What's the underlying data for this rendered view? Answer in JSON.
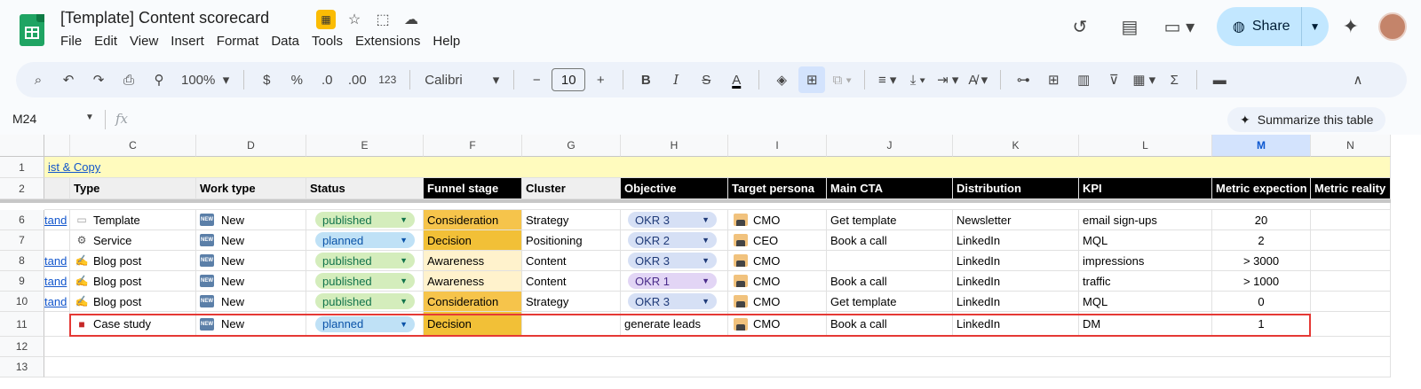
{
  "app": {
    "doc_title": "[Template] Content scorecard",
    "menu": [
      "File",
      "Edit",
      "View",
      "Insert",
      "Format",
      "Data",
      "Tools",
      "Extensions",
      "Help"
    ],
    "share_label": "Share"
  },
  "toolbar": {
    "zoom": "100%",
    "currency": "$",
    "percent": "%",
    "dec_decrease": ".0",
    "dec_increase": ".00",
    "number_format": "123",
    "font": "Calibri",
    "font_size": "10"
  },
  "formula_bar": {
    "name_box": "M24",
    "fx": "fx",
    "summarize": "Summarize this table"
  },
  "columns": [
    "C",
    "D",
    "E",
    "F",
    "G",
    "H",
    "I",
    "J",
    "K",
    "L",
    "M",
    "N"
  ],
  "rows": [
    "1",
    "2",
    "6",
    "7",
    "8",
    "9",
    "10",
    "11",
    "12",
    "13"
  ],
  "row1_link": "ist & Copy",
  "header_row": {
    "type": "Type",
    "work_type": "Work type",
    "status": "Status",
    "funnel": "Funnel stage",
    "cluster": "Cluster",
    "objective": "Objective",
    "persona": "Target persona",
    "cta": "Main CTA",
    "distribution": "Distribution",
    "kpi": "KPI",
    "metric_exp": "Metric expection",
    "metric_real": "Metric reality"
  },
  "data_rows": [
    {
      "b": "tand",
      "type": "Template",
      "work": "New",
      "status": "published",
      "funnel": "Consideration",
      "cluster": "Strategy",
      "objective": "OKR 3",
      "persona": "CMO",
      "cta": "Get template",
      "dist": "Newsletter",
      "kpi": "email sign-ups",
      "exp": "20"
    },
    {
      "b": "",
      "type": "Service",
      "work": "New",
      "status": "planned",
      "funnel": "Decision",
      "cluster": "Positioning",
      "objective": "OKR 2",
      "persona": "CEO",
      "cta": "Book a call",
      "dist": "LinkedIn",
      "kpi": "MQL",
      "exp": "2"
    },
    {
      "b": "tand",
      "type": "Blog post",
      "work": "New",
      "status": "published",
      "funnel": "Awareness",
      "cluster": "Content",
      "objective": "OKR 3",
      "persona": "CMO",
      "cta": "",
      "dist": "LinkedIn",
      "kpi": "impressions",
      "exp": "> 3000"
    },
    {
      "b": "tand",
      "type": "Blog post",
      "work": "New",
      "status": "published",
      "funnel": "Awareness",
      "cluster": "Content",
      "objective": "OKR 1",
      "persona": "CMO",
      "cta": "Book a call",
      "dist": "LinkedIn",
      "kpi": "traffic",
      "exp": "> 1000"
    },
    {
      "b": "tand",
      "type": "Blog post",
      "work": "New",
      "status": "published",
      "funnel": "Consideration",
      "cluster": "Strategy",
      "objective": "OKR 3",
      "persona": "CMO",
      "cta": "Get template",
      "dist": "LinkedIn",
      "kpi": "MQL",
      "exp": "0"
    },
    {
      "b": "",
      "type": "Case study",
      "work": "New",
      "status": "planned",
      "funnel": "Decision",
      "cluster": "",
      "objective": "generate leads",
      "persona": "CMO",
      "cta": "Book a call",
      "dist": "LinkedIn",
      "kpi": "DM",
      "exp": "1"
    }
  ],
  "icons": {
    "new_badge": "NEW"
  }
}
